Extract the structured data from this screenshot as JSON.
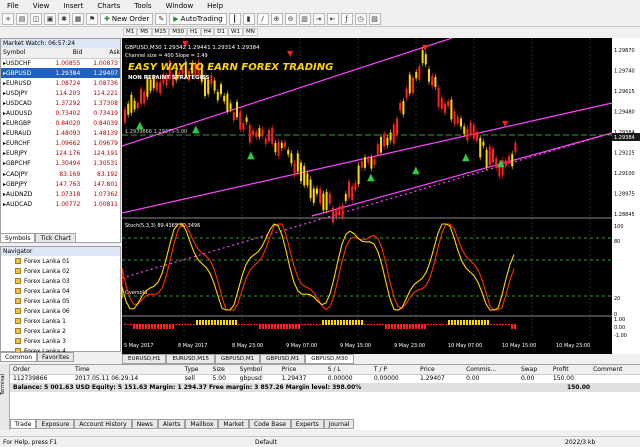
{
  "menu": [
    "File",
    "View",
    "Insert",
    "Charts",
    "Tools",
    "Window",
    "Help"
  ],
  "toolbar": {
    "new_order": "New Order",
    "autotrading": "AutoTrading"
  },
  "timeframes": [
    "M1",
    "M5",
    "M15",
    "M30",
    "H1",
    "H4",
    "D1",
    "W1",
    "MN"
  ],
  "market_watch": {
    "title": "Market Watch: 06:57:24",
    "headers": [
      "Symbol",
      "Bid",
      "Ask"
    ],
    "rows": [
      [
        "USDCHF",
        "1.00855",
        "1.00873"
      ],
      [
        "GBPUSD",
        "1.29384",
        "1.29407"
      ],
      [
        "EURUSD",
        "1.08724",
        "1.08736"
      ],
      [
        "USDJPY",
        "114.203",
        "114.221"
      ],
      [
        "USDCAD",
        "1.37292",
        "1.37308"
      ],
      [
        "AUDUSD",
        "0.73402",
        "0.73419"
      ],
      [
        "EURGBP",
        "0.84020",
        "0.84039"
      ],
      [
        "EURAUD",
        "1.48093",
        "1.48139"
      ],
      [
        "EURCHF",
        "1.09662",
        "1.09679"
      ],
      [
        "EURJPY",
        "124.176",
        "124.191"
      ],
      [
        "GBPCHF",
        "1.30494",
        "1.30531"
      ],
      [
        "CADJPY",
        "83.169",
        "83.192"
      ],
      [
        "GBPJPY",
        "147.763",
        "147.801"
      ],
      [
        "AUDNZD",
        "1.07318",
        "1.07362"
      ],
      [
        "AUDCAD",
        "1.00772",
        "1.00811"
      ]
    ],
    "tabs": [
      "Symbols",
      "Tick Chart"
    ]
  },
  "navigator": {
    "title": "Navigator",
    "items": [
      "Forex Lanka 01",
      "Forex Lanka 02",
      "Forex Lanka 03",
      "Forex Lanka 04",
      "Forex Lanka 05",
      "Forex Lanka 06",
      "Forex Lanka 1",
      "Forex Lanka 2",
      "Forex Lanka 3",
      "Forex Lanka 4"
    ],
    "tabs": [
      "Common",
      "Favorites"
    ]
  },
  "chart": {
    "header": "GBPUSD,M30  1.29342 1.29441 1.29314 1.29384",
    "line1": "Channel size = 400 Slope = 1.49",
    "banner": "EASY WAY TO EARN FOREX TRADING",
    "sub": "NON REPAINT STRATEGIES",
    "price_label": "1.2939866 1.29375-5.00",
    "osc_label": "Stoch(5,3,3) 89.4365 89.3496",
    "oversold": "Oversold",
    "prices": [
      "1.29870",
      "1.29740",
      "1.29615",
      "1.29480",
      "1.29384",
      "1.29225",
      "1.29100",
      "1.28975",
      "1.28845"
    ],
    "osc_ticks": [
      "100",
      "80",
      "20",
      "0"
    ],
    "bottom_ticks": [
      "1.00",
      "0.00",
      "-1.00"
    ],
    "dates": [
      "5 May 2017",
      "8 May 2017",
      "8 May 23:00",
      "9 May 07:00",
      "9 May 15:00",
      "9 May 23:00",
      "10 May 07:00",
      "10 May 15:00",
      "10 May 23:00"
    ],
    "colors": {
      "up": "#ffd700",
      "down": "#ff2020",
      "channel": "#ff44ff",
      "osc": "#ff3000",
      "osc2": "#ffd700"
    }
  },
  "chart_tabs": [
    "EURUSD,H1",
    "EURUSD,M15",
    "GBPUSD,M1",
    "GBPUSD,M1",
    "GBPUSD,M30"
  ],
  "terminal": {
    "headers": [
      "Order",
      "Time",
      "Type",
      "Size",
      "Symbol",
      "Price",
      "S / L",
      "T / P",
      "Price",
      "Commis...",
      "Swap",
      "Profit",
      "Comment"
    ],
    "row": [
      "112739866",
      "2017.05.11 06:29:14",
      "sell",
      "5.00",
      "gbpusd",
      "1.29437",
      "0.00000",
      "0.00000",
      "1.29407",
      "0.00",
      "0.00",
      "150.00",
      ""
    ],
    "balance": "Balance: 5 001.63 USD  Equity: 5 151.63  Margin: 1 294.37  Free margin: 3 857.26  Margin level: 398.00%",
    "balance_profit": "150.00",
    "tabs": [
      "Trade",
      "Exposure",
      "Account History",
      "News",
      "Alerts",
      "Mailbox",
      "Market",
      "Code Base",
      "Experts",
      "Journal"
    ],
    "side": "Terminal"
  },
  "status": {
    "help": "For Help, press F1",
    "profile": "Default",
    "traffic": "2022/3 kb"
  }
}
